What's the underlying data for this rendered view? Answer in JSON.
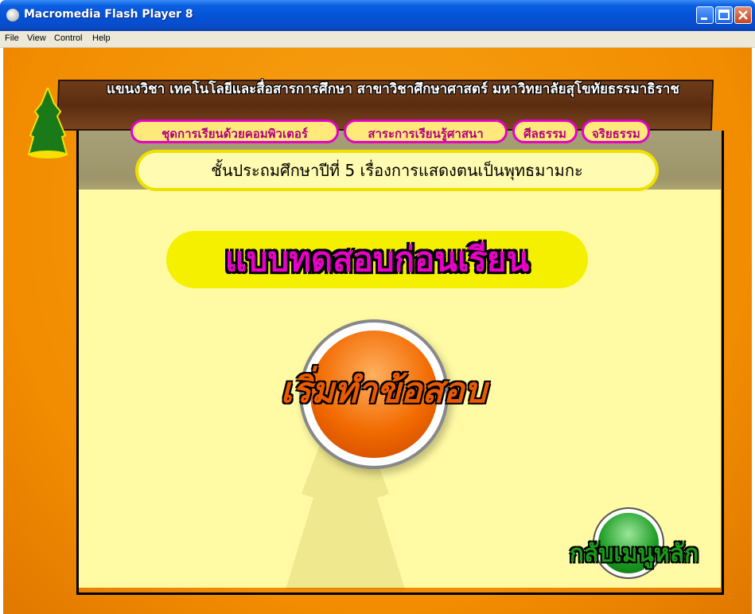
{
  "window": {
    "title": "Macromedia Flash Player 8",
    "menu": [
      "File",
      "View",
      "Control",
      "Help"
    ]
  },
  "header": {
    "institution": "แขนงวิชา เทคโนโลยีและสื่อสารการศึกษา สาขาวิชาศึกษาศาสตร์ มหาวิทยาลัยสุโขทัยธรรมาธิราช",
    "tags": [
      "ชุดการเรียนด้วยคอมพิวเตอร์",
      "สาระการเรียนรู้ศาสนา",
      "ศีลธรรม",
      "จริยธรรม"
    ],
    "subtitle": "ชั้นประถมศึกษาปีที่ 5 เรื่องการแสดงตนเป็นพุทธมามกะ"
  },
  "main": {
    "title": "แบบทดสอบก่อนเรียน",
    "start_button": "เริ่มทำข้อสอบ",
    "back_button": "กลับเมนูหลัก"
  },
  "colors": {
    "stage": "#f79a12",
    "board": "#fffaa3",
    "title_text": "#e800c8",
    "start_button": "#f26a00",
    "back_button": "#1a9a20"
  },
  "icons": [
    "flash-player-icon",
    "minimize-icon",
    "maximize-icon",
    "close-icon",
    "university-logo",
    "temple-watermark"
  ]
}
